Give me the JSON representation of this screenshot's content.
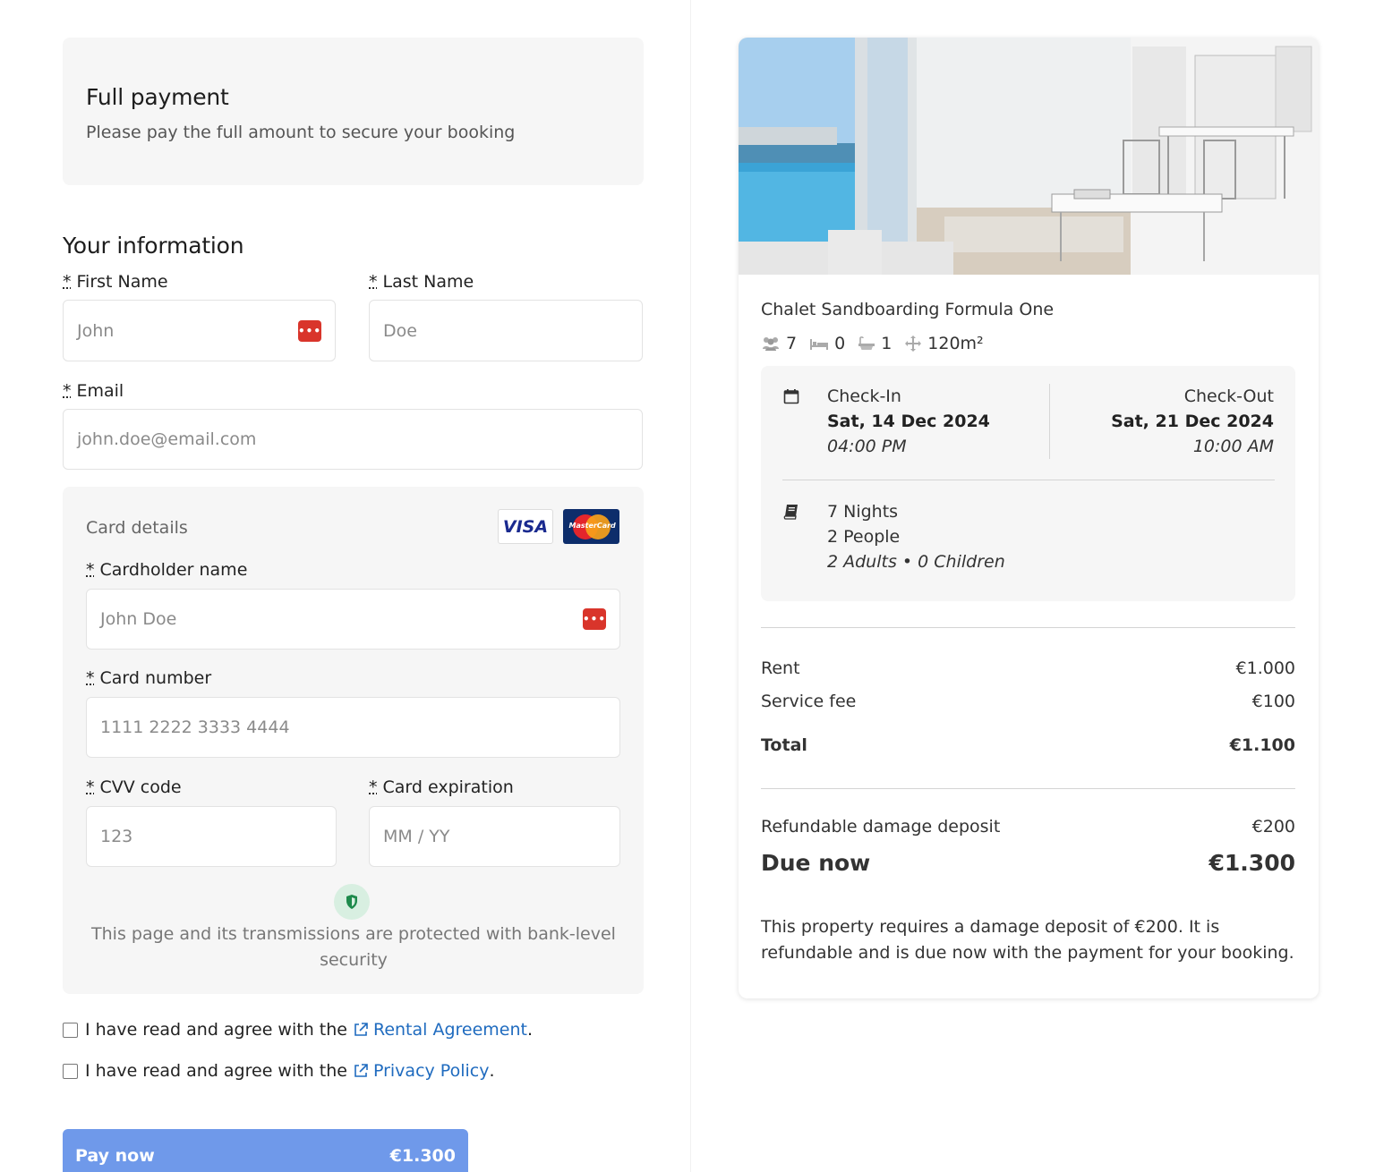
{
  "payment": {
    "title": "Full payment",
    "subtitle": "Please pay the full amount to secure your booking"
  },
  "info": {
    "title": "Your information",
    "first_name_label": "First Name",
    "first_name_placeholder": "John",
    "last_name_label": "Last Name",
    "last_name_placeholder": "Doe",
    "email_label": "Email",
    "email_placeholder": "john.doe@email.com",
    "required_mark": "*"
  },
  "card": {
    "title": "Card details",
    "visa_label": "VISA",
    "mastercard_label": "MasterCard",
    "holder_label": "Cardholder name",
    "holder_placeholder": "John Doe",
    "number_label": "Card number",
    "number_placeholder": "1111 2222 3333 4444",
    "cvv_label": "CVV code",
    "cvv_placeholder": "123",
    "exp_label": "Card expiration",
    "exp_placeholder": "MM / YY",
    "security_text": "This page and its transmissions are protected with bank-level security"
  },
  "agreements": [
    {
      "prefix": "I have read and agree with the",
      "link": "Rental Agreement",
      "suffix": "."
    },
    {
      "prefix": "I have read and agree with the",
      "link": "Privacy Policy",
      "suffix": "."
    }
  ],
  "pay_button": {
    "label": "Pay now",
    "amount": "€1.300",
    "color": "#6f99ea"
  },
  "property": {
    "name": "Chalet Sandboarding Formula One",
    "amenities": {
      "guests": "7",
      "beds": "0",
      "baths": "1",
      "area": "120m²"
    }
  },
  "stay": {
    "checkin_label": "Check-In",
    "checkin_date": "Sat, 14 Dec 2024",
    "checkin_time": "04:00 PM",
    "checkout_label": "Check-Out",
    "checkout_date": "Sat, 21 Dec 2024",
    "checkout_time": "10:00 AM",
    "nights": "7 Nights",
    "people": "2 People",
    "breakdown": "2 Adults • 0 Children"
  },
  "pricing": {
    "rent_label": "Rent",
    "rent": "€1.000",
    "fee_label": "Service fee",
    "fee": "€100",
    "total_label": "Total",
    "total": "€1.100",
    "deposit_label": "Refundable damage deposit",
    "deposit": "€200",
    "due_label": "Due now",
    "due": "€1.300",
    "note": "This property requires a damage deposit of €200. It is refundable and is due now with the payment for your booking."
  },
  "colors": {
    "accent": "#6f99ea",
    "link": "#1f6bbf",
    "password_icon": "#d9352b",
    "panel_bg": "#f6f6f6"
  }
}
